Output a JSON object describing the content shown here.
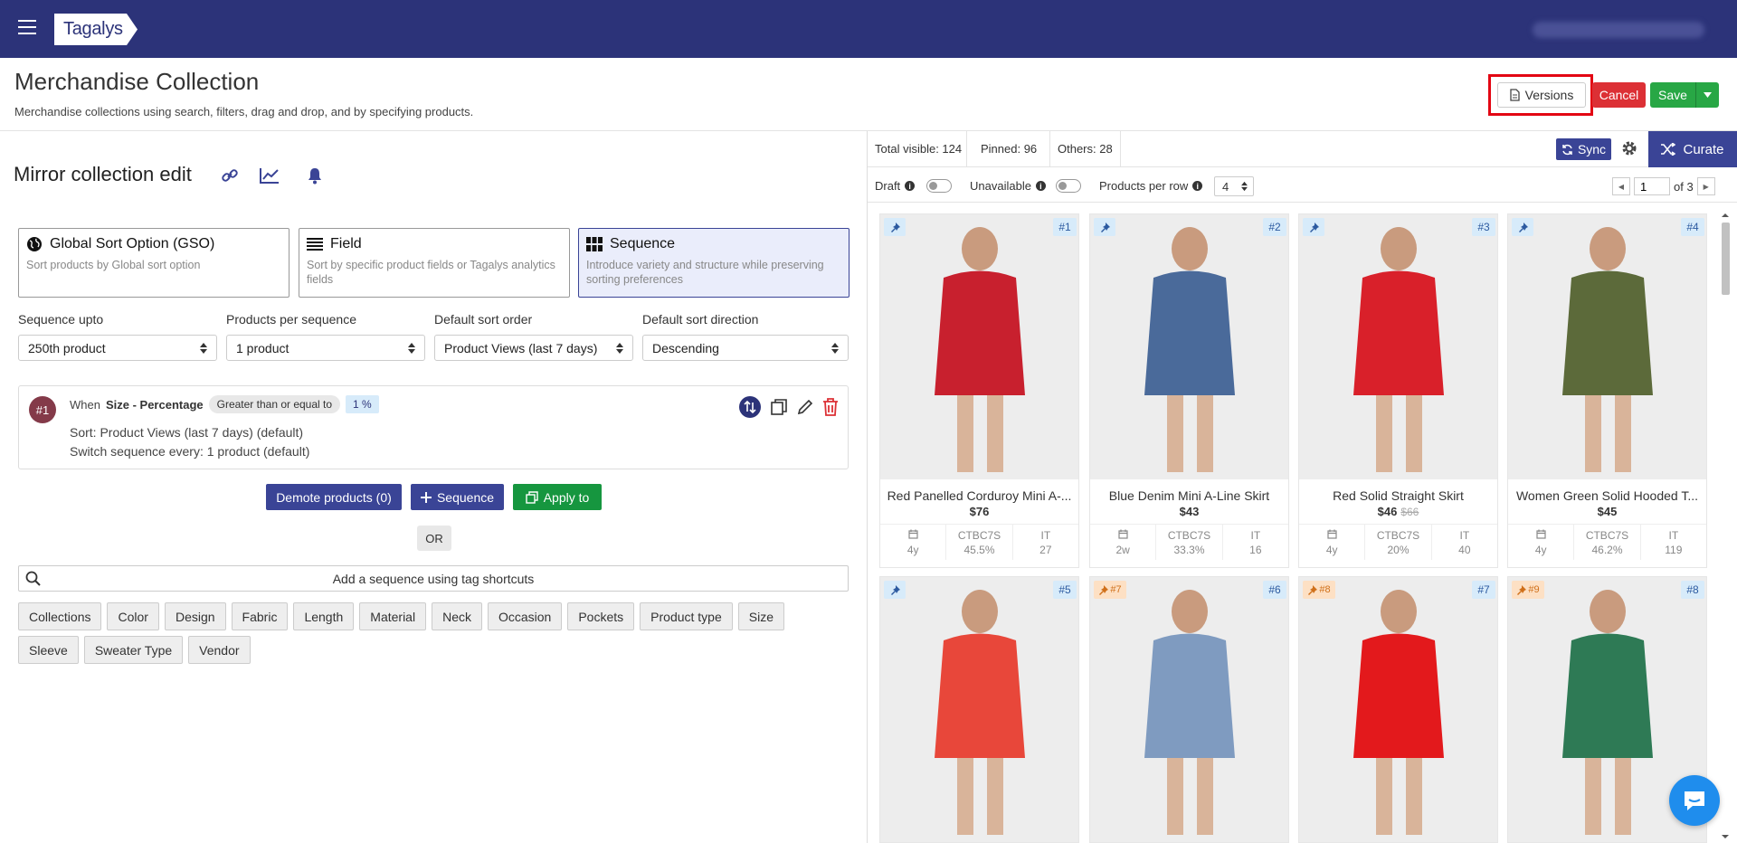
{
  "nav": {
    "logo": "Tagalys"
  },
  "header": {
    "title": "Merchandise Collection",
    "subtitle": "Merchandise collections using search, filters, drag and drop, and by specifying products.",
    "versions_label": "Versions",
    "cancel_label": "Cancel",
    "save_label": "Save"
  },
  "collection": {
    "title": "Mirror collection edit"
  },
  "sort_options": [
    {
      "title": "Global Sort Option (GSO)",
      "desc": "Sort products by Global sort option",
      "icon": "globe-icon"
    },
    {
      "title": "Field",
      "desc": "Sort by specific product fields or Tagalys analytics fields",
      "icon": "list-icon"
    },
    {
      "title": "Sequence",
      "desc": "Introduce variety and structure while preserving sorting preferences",
      "icon": "grid-icon"
    }
  ],
  "fields": [
    {
      "label": "Sequence upto",
      "value": "250th product"
    },
    {
      "label": "Products per sequence",
      "value": "1 product"
    },
    {
      "label": "Default sort order",
      "value": "Product Views (last 7 days)"
    },
    {
      "label": "Default sort direction",
      "value": "Descending"
    }
  ],
  "rule": {
    "num": "#1",
    "when": "When",
    "field": "Size - Percentage",
    "operator": "Greater than or equal to",
    "value": "1 %",
    "sort": "Sort: Product Views (last 7 days) (default)",
    "switch": "Switch sequence every: 1 product (default)"
  },
  "actions": {
    "demote": "Demote products (0)",
    "sequence": "Sequence",
    "apply": "Apply to",
    "or": "OR"
  },
  "tag_search": {
    "placeholder": "Add a sequence using tag shortcuts"
  },
  "tags": [
    "Collections",
    "Color",
    "Design",
    "Fabric",
    "Length",
    "Material",
    "Neck",
    "Occasion",
    "Pockets",
    "Product type",
    "Size",
    "Sleeve",
    "Sweater Type",
    "Vendor"
  ],
  "stats": {
    "visible": "Total visible: 124",
    "pinned": "Pinned: 96",
    "others": "Others: 28"
  },
  "right_actions": {
    "sync": "Sync",
    "curate": "Curate"
  },
  "controls": {
    "draft": "Draft",
    "unavailable": "Unavailable",
    "per_row_label": "Products per row",
    "per_row_value": "4",
    "page": "1",
    "page_total": "of 3"
  },
  "products": [
    {
      "name": "Red Panelled Corduroy Mini A-...",
      "price": "$76",
      "old_price": "",
      "rank": "#1",
      "pin": "",
      "m1": "4y",
      "m2_label": "CTBC7S",
      "m2": "45.5%",
      "m3_label": "IT",
      "m3": "27",
      "img": "#c8202e"
    },
    {
      "name": "Blue Denim Mini A-Line Skirt",
      "price": "$43",
      "old_price": "",
      "rank": "#2",
      "pin": "",
      "m1": "2w",
      "m2_label": "CTBC7S",
      "m2": "33.3%",
      "m3_label": "IT",
      "m3": "16",
      "img": "#4a6a9a"
    },
    {
      "name": "Red Solid Straight Skirt",
      "price": "$46",
      "old_price": "$66",
      "rank": "#3",
      "pin": "",
      "m1": "4y",
      "m2_label": "CTBC7S",
      "m2": "20%",
      "m3_label": "IT",
      "m3": "40",
      "img": "#d9202a"
    },
    {
      "name": "Women Green Solid Hooded T...",
      "price": "$45",
      "old_price": "",
      "rank": "#4",
      "pin": "",
      "m1": "4y",
      "m2_label": "CTBC7S",
      "m2": "46.2%",
      "m3_label": "IT",
      "m3": "119",
      "img": "#5c6a3a"
    },
    {
      "name": "",
      "price": "",
      "old_price": "",
      "rank": "#5",
      "pin": "",
      "m1": "",
      "m2_label": "",
      "m2": "",
      "m3_label": "",
      "m3": "",
      "img": "#e8473a"
    },
    {
      "name": "",
      "price": "",
      "old_price": "",
      "rank": "#6",
      "pin": "#7",
      "m1": "",
      "m2_label": "",
      "m2": "",
      "m3_label": "",
      "m3": "",
      "img": "#7f9bc0"
    },
    {
      "name": "",
      "price": "",
      "old_price": "",
      "rank": "#7",
      "pin": "#8",
      "m1": "",
      "m2_label": "",
      "m2": "",
      "m3_label": "",
      "m3": "",
      "img": "#e3191c"
    },
    {
      "name": "",
      "price": "",
      "old_price": "",
      "rank": "#8",
      "pin": "#9",
      "m1": "",
      "m2_label": "",
      "m2": "",
      "m3_label": "",
      "m3": "",
      "img": "#2e7a55"
    }
  ]
}
